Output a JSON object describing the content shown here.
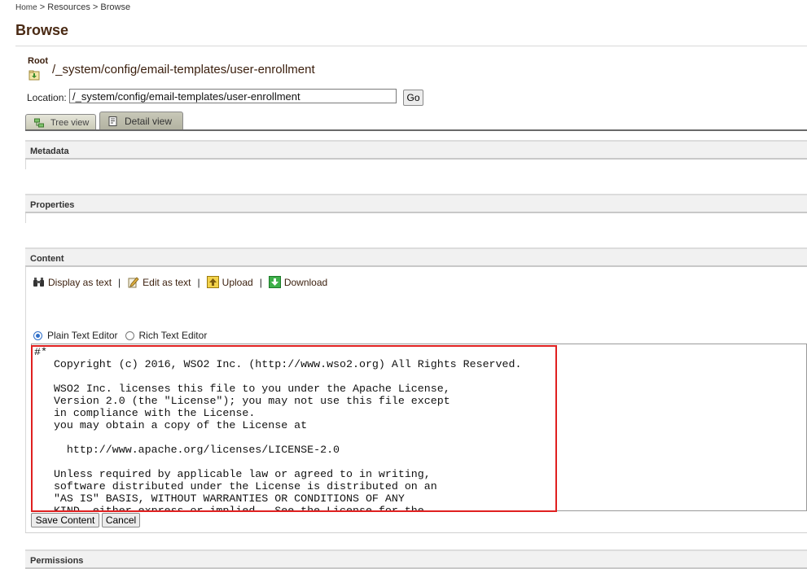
{
  "breadcrumb": {
    "home": "Home",
    "sep1": ">",
    "resources": "Resources",
    "sep2": ">",
    "current": "Browse"
  },
  "page": {
    "title": "Browse"
  },
  "resource": {
    "root_label": "Root",
    "path": "/_system/config/email-templates/user-enrollment"
  },
  "location": {
    "label": "Location:",
    "value": "/_system/config/email-templates/user-enrollment",
    "go_label": "Go"
  },
  "tabs": [
    {
      "label": "Tree view",
      "icon": "tree-icon",
      "active": false
    },
    {
      "label": "Detail view",
      "icon": "detail-icon",
      "active": true
    }
  ],
  "sections": {
    "metadata": "Metadata",
    "properties": "Properties",
    "content": "Content",
    "permissions": "Permissions"
  },
  "content_actions": {
    "display": "Display as text",
    "edit": "Edit as text",
    "upload": "Upload",
    "download": "Download",
    "separator": "|"
  },
  "editor_modes": {
    "plain": "Plain Text Editor",
    "rich": "Rich Text Editor",
    "selected": "plain"
  },
  "editor": {
    "text": "#*\n   Copyright (c) 2016, WSO2 Inc. (http://www.wso2.org) All Rights Reserved.\n\n   WSO2 Inc. licenses this file to you under the Apache License,\n   Version 2.0 (the \"License\"); you may not use this file except\n   in compliance with the License.\n   you may obtain a copy of the License at\n\n     http://www.apache.org/licenses/LICENSE-2.0\n\n   Unless required by applicable law or agreed to in writing,\n   software distributed under the License is distributed on an\n   \"AS IS\" BASIS, WITHOUT WARRANTIES OR CONDITIONS OF ANY\n   KIND, either express or implied.  See the License for the"
  },
  "buttons": {
    "save": "Save Content",
    "cancel": "Cancel"
  },
  "colors": {
    "highlight": "#e02020",
    "title": "#4a2a14",
    "radio_accent": "#2f6fc9"
  }
}
